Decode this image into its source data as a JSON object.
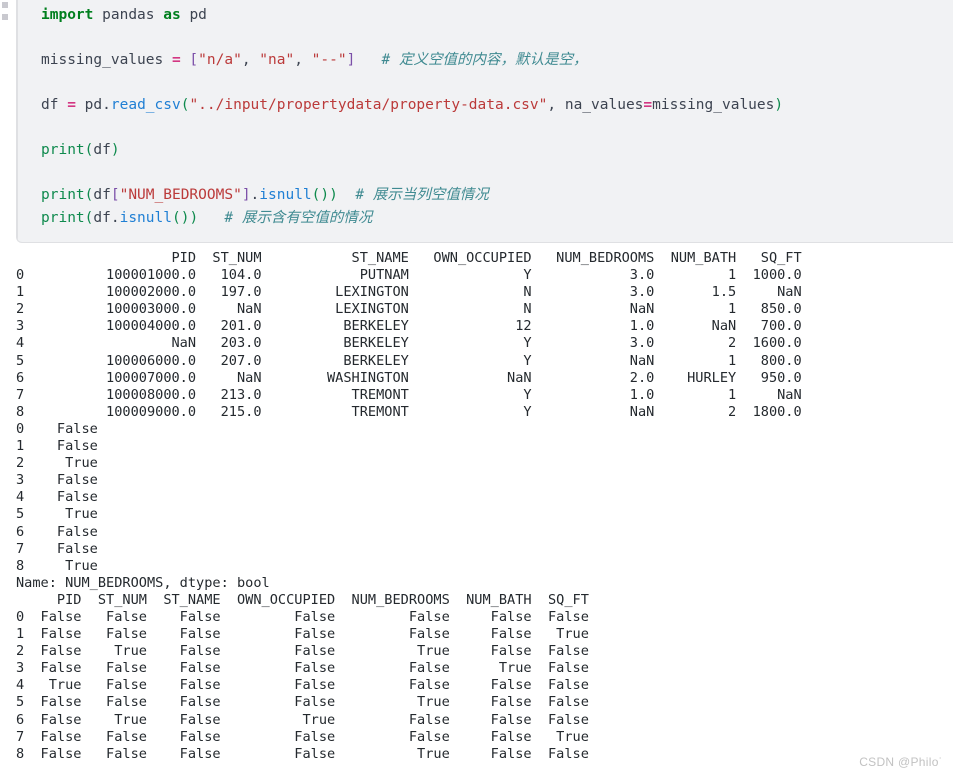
{
  "notebook": {
    "cell_type": "code",
    "code_lines": [
      [
        {
          "t": "import",
          "c": "kw"
        },
        {
          "t": " ",
          "c": "plain"
        },
        {
          "t": "pandas",
          "c": "name"
        },
        {
          "t": " ",
          "c": "plain"
        },
        {
          "t": "as",
          "c": "kw"
        },
        {
          "t": " ",
          "c": "plain"
        },
        {
          "t": "pd",
          "c": "name"
        }
      ],
      [],
      [
        {
          "t": "missing_values ",
          "c": "name"
        },
        {
          "t": "=",
          "c": "op"
        },
        {
          "t": " ",
          "c": "plain"
        },
        {
          "t": "[",
          "c": "brk"
        },
        {
          "t": "\"n/a\"",
          "c": "str"
        },
        {
          "t": ", ",
          "c": "plain"
        },
        {
          "t": "\"na\"",
          "c": "str"
        },
        {
          "t": ", ",
          "c": "plain"
        },
        {
          "t": "\"--\"",
          "c": "str"
        },
        {
          "t": "]",
          "c": "brk"
        },
        {
          "t": "   ",
          "c": "plain"
        },
        {
          "t": "# 定义空值的内容，默认是空，",
          "c": "comment"
        }
      ],
      [],
      [
        {
          "t": "df ",
          "c": "name"
        },
        {
          "t": "=",
          "c": "op"
        },
        {
          "t": " ",
          "c": "plain"
        },
        {
          "t": "pd",
          "c": "name"
        },
        {
          "t": ".",
          "c": "plain"
        },
        {
          "t": "read_csv",
          "c": "fn"
        },
        {
          "t": "(",
          "c": "punc"
        },
        {
          "t": "\"../input/propertydata/property-data.csv\"",
          "c": "str"
        },
        {
          "t": ", ",
          "c": "plain"
        },
        {
          "t": "na_values",
          "c": "name"
        },
        {
          "t": "=",
          "c": "op"
        },
        {
          "t": "missing_values",
          "c": "name"
        },
        {
          "t": ")",
          "c": "punc"
        }
      ],
      [],
      [
        {
          "t": "print",
          "c": "builtin"
        },
        {
          "t": "(",
          "c": "punc"
        },
        {
          "t": "df",
          "c": "name"
        },
        {
          "t": ")",
          "c": "punc"
        }
      ],
      [],
      [
        {
          "t": "print",
          "c": "builtin"
        },
        {
          "t": "(",
          "c": "punc"
        },
        {
          "t": "df",
          "c": "name"
        },
        {
          "t": "[",
          "c": "brk"
        },
        {
          "t": "\"NUM_BEDROOMS\"",
          "c": "str"
        },
        {
          "t": "]",
          "c": "brk"
        },
        {
          "t": ".",
          "c": "plain"
        },
        {
          "t": "isnull",
          "c": "fn"
        },
        {
          "t": "(",
          "c": "punc"
        },
        {
          "t": ")",
          "c": "punc"
        },
        {
          "t": ")",
          "c": "punc"
        },
        {
          "t": "  ",
          "c": "plain"
        },
        {
          "t": "# 展示当列空值情况",
          "c": "comment"
        }
      ],
      [
        {
          "t": "print",
          "c": "builtin"
        },
        {
          "t": "(",
          "c": "punc"
        },
        {
          "t": "df",
          "c": "name"
        },
        {
          "t": ".",
          "c": "plain"
        },
        {
          "t": "isnull",
          "c": "fn"
        },
        {
          "t": "(",
          "c": "punc"
        },
        {
          "t": ")",
          "c": "punc"
        },
        {
          "t": ")",
          "c": "punc"
        },
        {
          "t": "   ",
          "c": "plain"
        },
        {
          "t": "# 展示含有空值的情况",
          "c": "comment"
        }
      ]
    ]
  },
  "output": {
    "dataframe_print": {
      "columns": [
        "PID",
        "ST_NUM",
        "ST_NAME",
        "OWN_OCCUPIED",
        "NUM_BEDROOMS",
        "NUM_BATH",
        "SQ_FT"
      ],
      "index": [
        "0",
        "1",
        "2",
        "3",
        "4",
        "5",
        "6",
        "7",
        "8"
      ],
      "rows": [
        [
          "100001000.0",
          "104.0",
          "PUTNAM",
          "Y",
          "3.0",
          "1",
          "1000.0"
        ],
        [
          "100002000.0",
          "197.0",
          "LEXINGTON",
          "N",
          "3.0",
          "1.5",
          "NaN"
        ],
        [
          "100003000.0",
          "NaN",
          "LEXINGTON",
          "N",
          "NaN",
          "1",
          "850.0"
        ],
        [
          "100004000.0",
          "201.0",
          "BERKELEY",
          "12",
          "1.0",
          "NaN",
          "700.0"
        ],
        [
          "NaN",
          "203.0",
          "BERKELEY",
          "Y",
          "3.0",
          "2",
          "1600.0"
        ],
        [
          "100006000.0",
          "207.0",
          "BERKELEY",
          "Y",
          "NaN",
          "1",
          "800.0"
        ],
        [
          "100007000.0",
          "NaN",
          "WASHINGTON",
          "NaN",
          "2.0",
          "HURLEY",
          "950.0"
        ],
        [
          "100008000.0",
          "213.0",
          "TREMONT",
          "Y",
          "1.0",
          "1",
          "NaN"
        ],
        [
          "100009000.0",
          "215.0",
          "TREMONT",
          "Y",
          "NaN",
          "2",
          "1800.0"
        ]
      ]
    },
    "series_print": {
      "index": [
        "0",
        "1",
        "2",
        "3",
        "4",
        "5",
        "6",
        "7",
        "8"
      ],
      "values": [
        "False",
        "False",
        "True",
        "False",
        "False",
        "True",
        "False",
        "False",
        "True"
      ],
      "footer": "Name: NUM_BEDROOMS, dtype: bool"
    },
    "isnull_frame_print": {
      "columns": [
        "PID",
        "ST_NUM",
        "ST_NAME",
        "OWN_OCCUPIED",
        "NUM_BEDROOMS",
        "NUM_BATH",
        "SQ_FT"
      ],
      "index": [
        "0",
        "1",
        "2",
        "3",
        "4",
        "5",
        "6",
        "7",
        "8"
      ],
      "rows": [
        [
          "False",
          "False",
          "False",
          "False",
          "False",
          "False",
          "False"
        ],
        [
          "False",
          "False",
          "False",
          "False",
          "False",
          "False",
          "True"
        ],
        [
          "False",
          "True",
          "False",
          "False",
          "True",
          "False",
          "False"
        ],
        [
          "False",
          "False",
          "False",
          "False",
          "False",
          "True",
          "False"
        ],
        [
          "True",
          "False",
          "False",
          "False",
          "False",
          "False",
          "False"
        ],
        [
          "False",
          "False",
          "False",
          "False",
          "True",
          "False",
          "False"
        ],
        [
          "False",
          "True",
          "False",
          "True",
          "False",
          "False",
          "False"
        ],
        [
          "False",
          "False",
          "False",
          "False",
          "False",
          "False",
          "True"
        ],
        [
          "False",
          "False",
          "False",
          "False",
          "True",
          "False",
          "False"
        ]
      ]
    }
  },
  "watermark": {
    "text": "CSDN @Philo˙"
  },
  "colors": {
    "cell_background": "#f1f2f4",
    "cell_border": "#dfe0e3",
    "keyword": "#007f1e",
    "string": "#bb3a3a",
    "operator": "#d33682",
    "function": "#1f7fd4",
    "builtin": "#0e8a4d",
    "bracket": "#7b4fa8",
    "comment": "#3f8a91",
    "output_text": "#24292e",
    "watermark": "#c2c2c2"
  }
}
